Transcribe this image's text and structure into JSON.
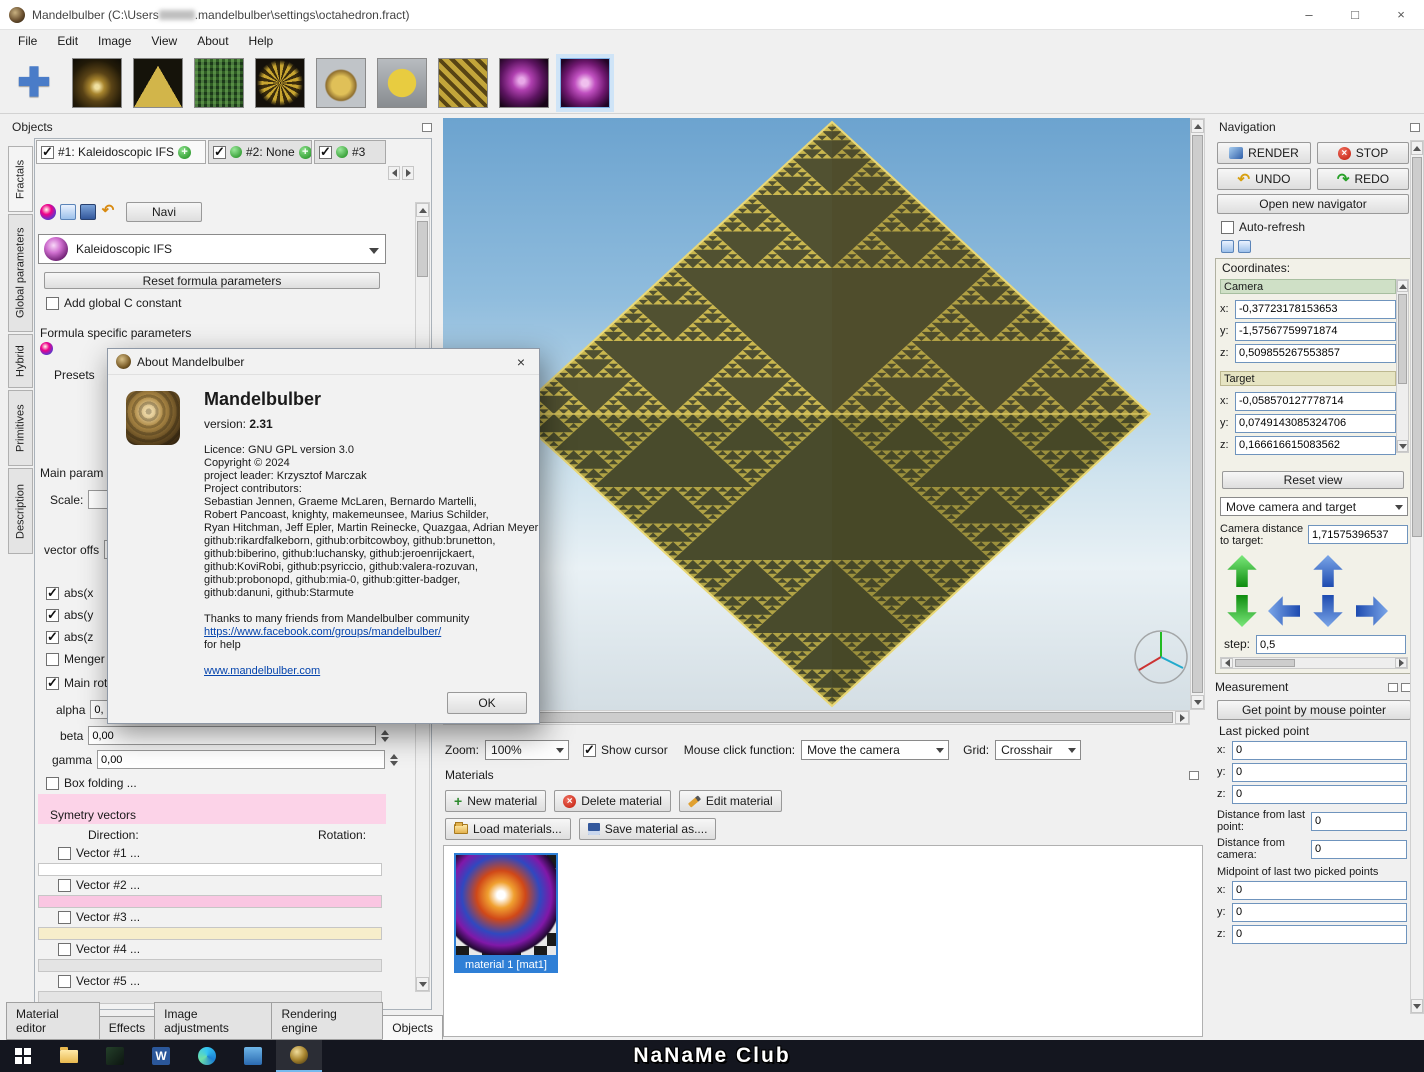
{
  "icons": {
    "minimize": "–",
    "maximize": "□",
    "close": "×"
  },
  "axis": {
    "x": "x:",
    "y": "y:",
    "z": "z:"
  },
  "titlebar": {
    "title_prefix": "Mandelbulber (C:\\Users",
    "title_suffix": ".mandelbulber\\settings\\octahedron.fract)"
  },
  "menubar": {
    "items": [
      "File",
      "Edit",
      "Image",
      "View",
      "About",
      "Help"
    ]
  },
  "toolbar": {
    "preset_icons": [
      "mandelbulb-gold",
      "sierpinski-pyramid",
      "menger-sponge-green",
      "ifs-flower-gold",
      "amazing-surf-gold",
      "menger-cube-yellow",
      "menger-gold",
      "mandelbox-purple",
      "kaleidoscopic-ifs-purple"
    ],
    "selected_index": 8
  },
  "objects_panel": {
    "title": "Objects",
    "side_tabs": [
      "Fractals",
      "Global parameters",
      "Hybrid",
      "Primitives",
      "Description"
    ],
    "slots": [
      {
        "label": "#1: Kaleidoscopic IFS"
      },
      {
        "label": "#2: None"
      },
      {
        "label": "#3"
      }
    ],
    "navi_button": "Navi",
    "formula_name": "Kaleidoscopic IFS",
    "reset_formula_button": "Reset formula parameters",
    "add_global_c_label": "Add global C constant",
    "formula_specific_label": "Formula specific parameters",
    "presets_label": "Presets",
    "main_parameters_label": "Main param",
    "scale_label": "Scale:",
    "vector_offset_label": "vector offs",
    "abs_x_label": "abs(x",
    "abs_y_label": "abs(y",
    "abs_z_label": "abs(z",
    "menger_label": "Menger",
    "main_rot_label": "Main rot",
    "alpha_label": "alpha",
    "alpha_value": "0,",
    "beta_label": "beta",
    "beta_value": "0,00",
    "gamma_label": "gamma",
    "gamma_value": "0,00",
    "box_folding_label": "Box folding ...",
    "symmetry_title": "Symetry vectors",
    "direction_label": "Direction:",
    "rotation_label": "Rotation:",
    "vectors": [
      "Vector #1 ...",
      "Vector #2 ...",
      "Vector #3 ...",
      "Vector #4 ...",
      "Vector #5 ..."
    ]
  },
  "bottom_tabs": {
    "items": [
      "Material editor",
      "Effects",
      "Image adjustments",
      "Rendering engine",
      "Objects"
    ],
    "active": "Objects"
  },
  "viewport": {
    "zoom_label": "Zoom:",
    "zoom_value": "100%",
    "show_cursor_label": "Show cursor",
    "mouse_function_label": "Mouse click function:",
    "mouse_function_value": "Move the camera",
    "grid_label": "Grid:",
    "grid_value": "Crosshair"
  },
  "materials": {
    "title": "Materials",
    "new_button": "New material",
    "delete_button": "Delete material",
    "edit_button": "Edit material",
    "load_button": "Load materials...",
    "save_button": "Save material as....",
    "items": [
      {
        "caption": "material 1 [mat1]"
      }
    ]
  },
  "navigation": {
    "title": "Navigation",
    "render_button": "RENDER",
    "stop_button": "STOP",
    "undo_button": "UNDO",
    "redo_button": "REDO",
    "open_navigator_button": "Open new navigator",
    "auto_refresh_label": "Auto-refresh",
    "coordinates_title": "Coordinates:",
    "camera_title": "Camera",
    "camera": {
      "x": "-0,37723178153653",
      "y": "-1,57567759971874",
      "z": "0,509855267553857"
    },
    "target_title": "Target",
    "target": {
      "x": "-0,058570127778714",
      "y": "0,0749143085324706",
      "z": "0,166616615083562"
    },
    "reset_view_button": "Reset view",
    "move_mode_value": "Move camera and target",
    "camera_distance_label": "Camera distance to target:",
    "camera_distance_value": "1,71575396537",
    "step_label": "step:",
    "step_value": "0,5"
  },
  "measurement": {
    "title": "Measurement",
    "get_point_button": "Get point by mouse pointer",
    "last_picked_label": "Last picked point",
    "point": {
      "x": "0",
      "y": "0",
      "z": "0"
    },
    "distance_last_label": "Distance from last point:",
    "distance_last_value": "0",
    "distance_camera_label": "Distance from camera:",
    "distance_camera_value": "0",
    "midpoint_label": "Midpoint of last two picked points",
    "midpoint": {
      "x": "0",
      "y": "0",
      "z": "0"
    }
  },
  "about_dialog": {
    "title": "About Mandelbulber",
    "app_name": "Mandelbulber",
    "version_label": "version:",
    "version_value": "2.31",
    "licence": "Licence: GNU GPL version 3.0",
    "copyright": "Copyright © 2024",
    "project_leader": "project leader: Krzysztof Marczak",
    "contributors_label": "Project contributors:",
    "contributors": [
      "Sebastian Jennen, Graeme McLaren, Bernardo Martelli,",
      "Robert Pancoast, knighty, makemeunsee, Marius Schilder,",
      "Ryan Hitchman, Jeff Epler, Martin Reinecke, Quazgaa, Adrian Meyer",
      "github:rikardfalkeborn, github:orbitcowboy, github:brunetton,",
      "github:biberino, github:luchansky, github:jeroenrijckaert,",
      "github:KoviRobi, github:psyriccio, github:valera-rozuvan,",
      "github:probonopd, github:mia-0, github:gitter-badger,",
      "github:danuni, github:Starmute"
    ],
    "thanks_line": "Thanks to many friends from Mandelbulber community",
    "facebook_link": "https://www.facebook.com/groups/mandelbulber/",
    "for_help": "for help",
    "website_link": "www.mandelbulber.com",
    "ok_button": "OK"
  },
  "taskbar": {
    "brand": "NaNaMe Club"
  }
}
